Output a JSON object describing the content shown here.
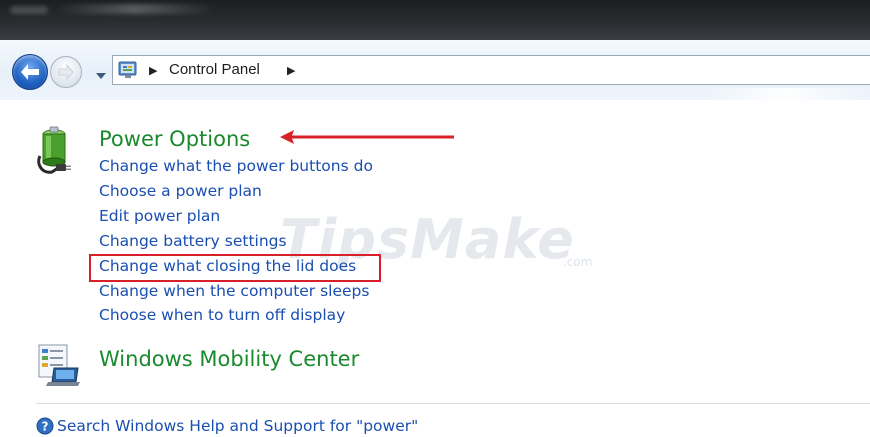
{
  "nav": {
    "breadcrumb": [
      "Control Panel"
    ]
  },
  "power_options": {
    "title": "Power Options",
    "tasks": [
      "Change what the power buttons do",
      "Choose a power plan",
      "Edit power plan",
      "Change battery settings",
      "Change what closing the lid does",
      "Change when the computer sleeps",
      "Choose when to turn off display"
    ],
    "highlighted_task_index": 4
  },
  "mobility_center": {
    "title": "Windows Mobility Center"
  },
  "help": {
    "link": "Search Windows Help and Support for \"power\""
  },
  "watermark": {
    "brand": "TipsMake",
    "suffix": ".com"
  },
  "colors": {
    "section_title": "#1a8a2e",
    "link": "#1a4fb0",
    "annotation_red": "#d8202a"
  },
  "icons": {
    "back": "back-arrow-icon",
    "forward": "forward-arrow-icon",
    "control_panel": "control-panel-icon",
    "power_options": "battery-plug-icon",
    "mobility_center": "mobility-center-icon",
    "help": "help-icon"
  }
}
